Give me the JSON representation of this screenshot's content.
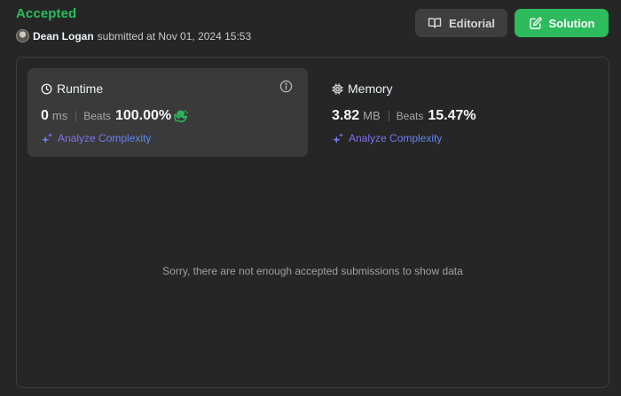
{
  "header": {
    "status": "Accepted",
    "username": "Dean Logan",
    "submitted_text": "submitted at Nov 01, 2024 15:53",
    "editorial_label": "Editorial",
    "solution_label": "Solution"
  },
  "runtime": {
    "title": "Runtime",
    "value": "0",
    "unit": "ms",
    "beats_label": "Beats",
    "beats_value": "100.00%",
    "analyze_label": "Analyze Complexity"
  },
  "memory": {
    "title": "Memory",
    "value": "3.82",
    "unit": "MB",
    "beats_label": "Beats",
    "beats_value": "15.47%",
    "analyze_label": "Analyze Complexity"
  },
  "empty_message": "Sorry, there are not enough accepted submissions to show data",
  "icons": {
    "editorial": "book-icon",
    "solution": "edit-icon",
    "runtime": "clock-icon",
    "memory": "chip-icon",
    "info": "info-icon",
    "beats_badge": "clap-icon",
    "analyze": "sparkle-icon"
  },
  "colors": {
    "accepted": "#2cbb5d",
    "solution_button": "#2cbb5d",
    "background": "#262626",
    "card_active": "#3a3a3a"
  }
}
